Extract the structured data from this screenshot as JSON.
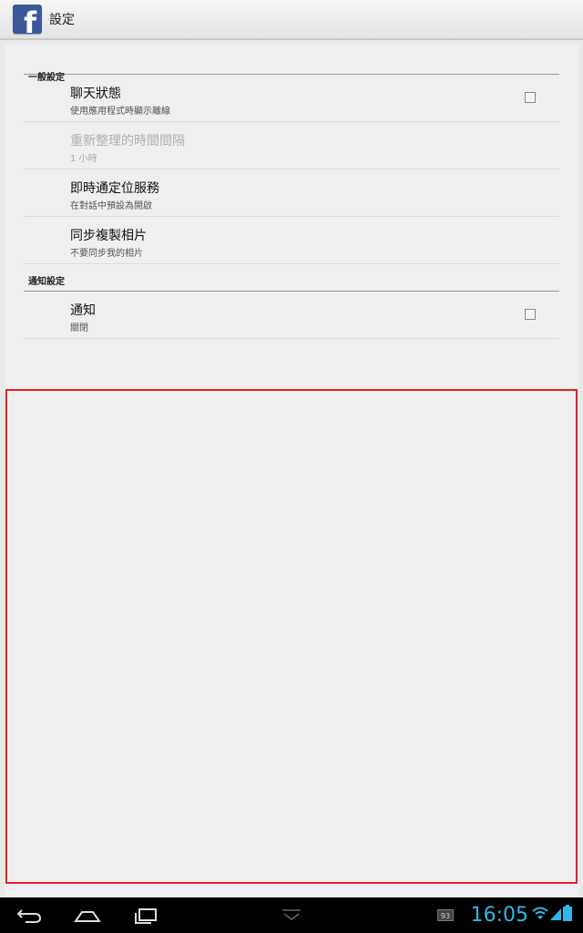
{
  "header": {
    "title": "設定",
    "logo_letter": "f",
    "brand_color": "#3b5998"
  },
  "sections": [
    {
      "category": "一般設定",
      "items": [
        {
          "title": "聊天狀態",
          "summary": "使用應用程式時顯示離線",
          "checkbox": true,
          "enabled": true
        },
        {
          "title": "重新整理的時間間隔",
          "summary": "1 小時",
          "checkbox": false,
          "enabled": false
        },
        {
          "title": "即時通定位服務",
          "summary": "在對話中預設為開啟",
          "checkbox": false,
          "enabled": true
        },
        {
          "title": "同步複製相片",
          "summary": "不要同步我的相片",
          "checkbox": false,
          "enabled": true
        }
      ]
    },
    {
      "category": "通知設定",
      "items": [
        {
          "title": "通知",
          "summary": "關閉",
          "checkbox": true,
          "enabled": true
        }
      ]
    }
  ],
  "status_bar": {
    "time": "16:05",
    "badge": "93",
    "accent": "#33b5e5"
  },
  "highlight_color": "#e0202a"
}
